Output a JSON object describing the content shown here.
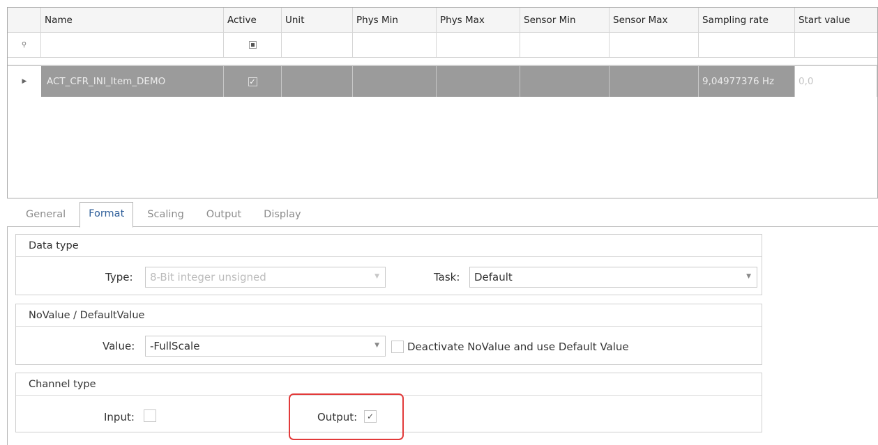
{
  "grid": {
    "columns": [
      "Name",
      "Active",
      "Unit",
      "Phys Min",
      "Phys Max",
      "Sensor Min",
      "Sensor Max",
      "Sampling rate",
      "Start value"
    ],
    "rows": [
      {
        "name": "ACT_CFR_INI_Item_DEMO",
        "active": true,
        "unit": "",
        "phys_min": "",
        "phys_max": "",
        "sensor_min": "",
        "sensor_max": "",
        "sampling_rate": "9,04977376 Hz",
        "start_value": "0,0"
      }
    ]
  },
  "tabs": [
    "General",
    "Format",
    "Scaling",
    "Output",
    "Display"
  ],
  "active_tab": "Format",
  "format": {
    "data_type": {
      "title": "Data type",
      "type_label": "Type:",
      "type_value": "8-Bit integer unsigned",
      "task_label": "Task:",
      "task_value": "Default"
    },
    "novalue": {
      "title": "NoValue / DefaultValue",
      "value_label": "Value:",
      "value_value": "-FullScale",
      "deactivate_label": "Deactivate NoValue and use Default Value",
      "deactivate_checked": false
    },
    "channel_type": {
      "title": "Channel type",
      "input_label": "Input:",
      "input_checked": false,
      "output_label": "Output:",
      "output_checked": true
    }
  },
  "colors": {
    "selected_row": "#9b9b9b",
    "active_tab_text": "#2f5f9a",
    "highlight": "#e23a3a"
  }
}
